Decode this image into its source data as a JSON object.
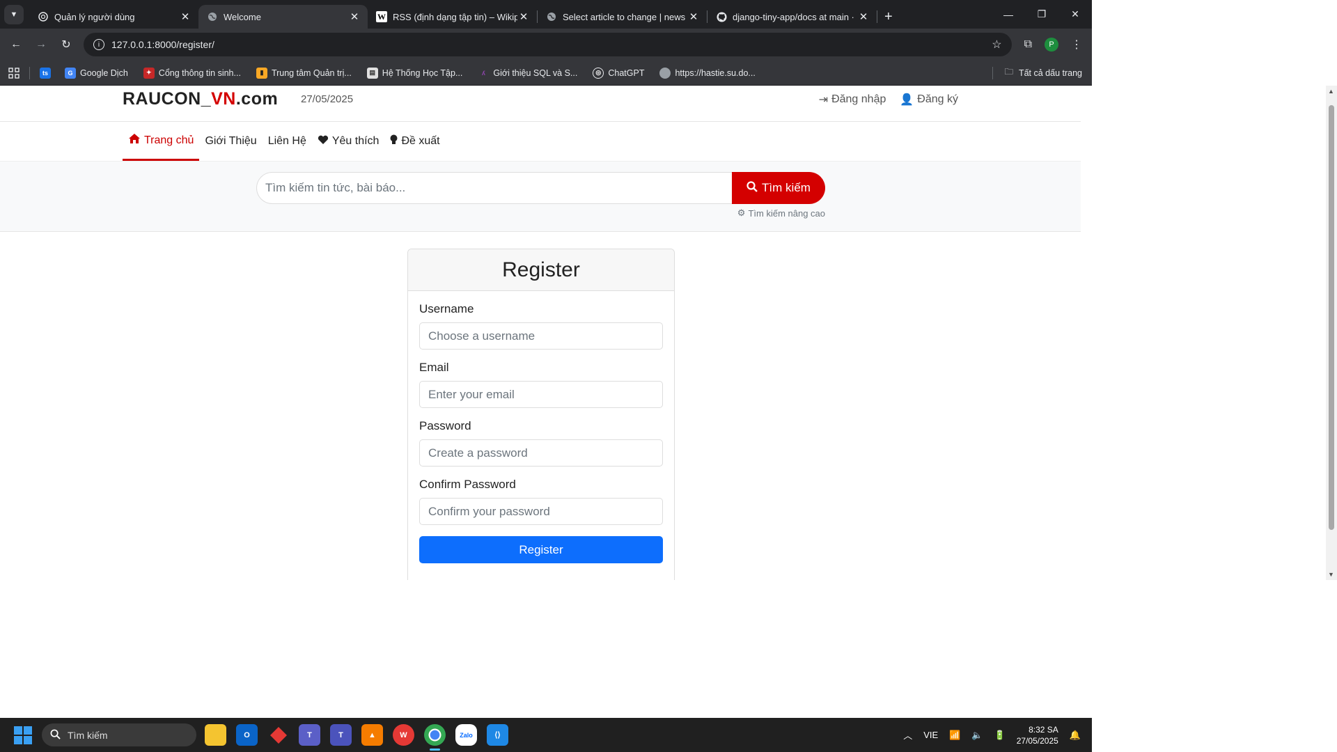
{
  "browser": {
    "tabs": [
      {
        "title": "Quản lý người dùng",
        "icon": "chatgpt-icon",
        "active": false
      },
      {
        "title": "Welcome",
        "icon": "globe-icon",
        "active": true
      },
      {
        "title": "RSS (định dạng tập tin) – Wikip",
        "icon": "wikipedia-icon",
        "active": false
      },
      {
        "title": "Select article to change | news a",
        "icon": "globe-icon",
        "active": false
      },
      {
        "title": "django-tiny-app/docs at main ·",
        "icon": "github-icon",
        "active": false
      }
    ],
    "url": "127.0.0.1:8000/register/",
    "profile_initial": "P",
    "bookmarks": [
      {
        "label": "",
        "icon": "ts-icon"
      },
      {
        "label": "Google Dịch",
        "icon": "google-translate-icon"
      },
      {
        "label": "Cổng thông tin sinh...",
        "icon": "portal-icon"
      },
      {
        "label": "Trung tâm Quản trị...",
        "icon": "admin-icon"
      },
      {
        "label": "Hệ Thống Học Tập...",
        "icon": "learning-icon"
      },
      {
        "label": "Giới thiệu SQL và S...",
        "icon": "sql-icon"
      },
      {
        "label": "ChatGPT",
        "icon": "chatgpt-icon"
      },
      {
        "label": "https://hastie.su.do...",
        "icon": "globe-icon"
      }
    ],
    "all_bookmarks": "Tất cả dấu trang"
  },
  "site": {
    "logo_part1": "RAUCON_",
    "logo_part2": "VN",
    "logo_part3": ".com",
    "date": "27/05/2025",
    "login": "Đăng nhập",
    "signup": "Đăng ký",
    "nav": [
      {
        "label": "Trang chủ",
        "icon": "home-icon",
        "active": true
      },
      {
        "label": "Giới Thiệu",
        "icon": "",
        "active": false
      },
      {
        "label": "Liên Hệ",
        "icon": "",
        "active": false
      },
      {
        "label": "Yêu thích",
        "icon": "heart-icon",
        "active": false
      },
      {
        "label": "Đề xuất",
        "icon": "lightbulb-icon",
        "active": false
      }
    ],
    "search_placeholder": "Tìm kiếm tin tức, bài báo...",
    "search_button": "Tìm kiếm",
    "advanced_search": "Tìm kiếm nâng cao"
  },
  "register": {
    "title": "Register",
    "fields": [
      {
        "label": "Username",
        "placeholder": "Choose a username"
      },
      {
        "label": "Email",
        "placeholder": "Enter your email"
      },
      {
        "label": "Password",
        "placeholder": "Create a password"
      },
      {
        "label": "Confirm Password",
        "placeholder": "Confirm your password"
      }
    ],
    "submit": "Register"
  },
  "taskbar": {
    "search": "Tìm kiếm",
    "language": "VIE",
    "time": "8:32 SA",
    "date": "27/05/2025"
  }
}
